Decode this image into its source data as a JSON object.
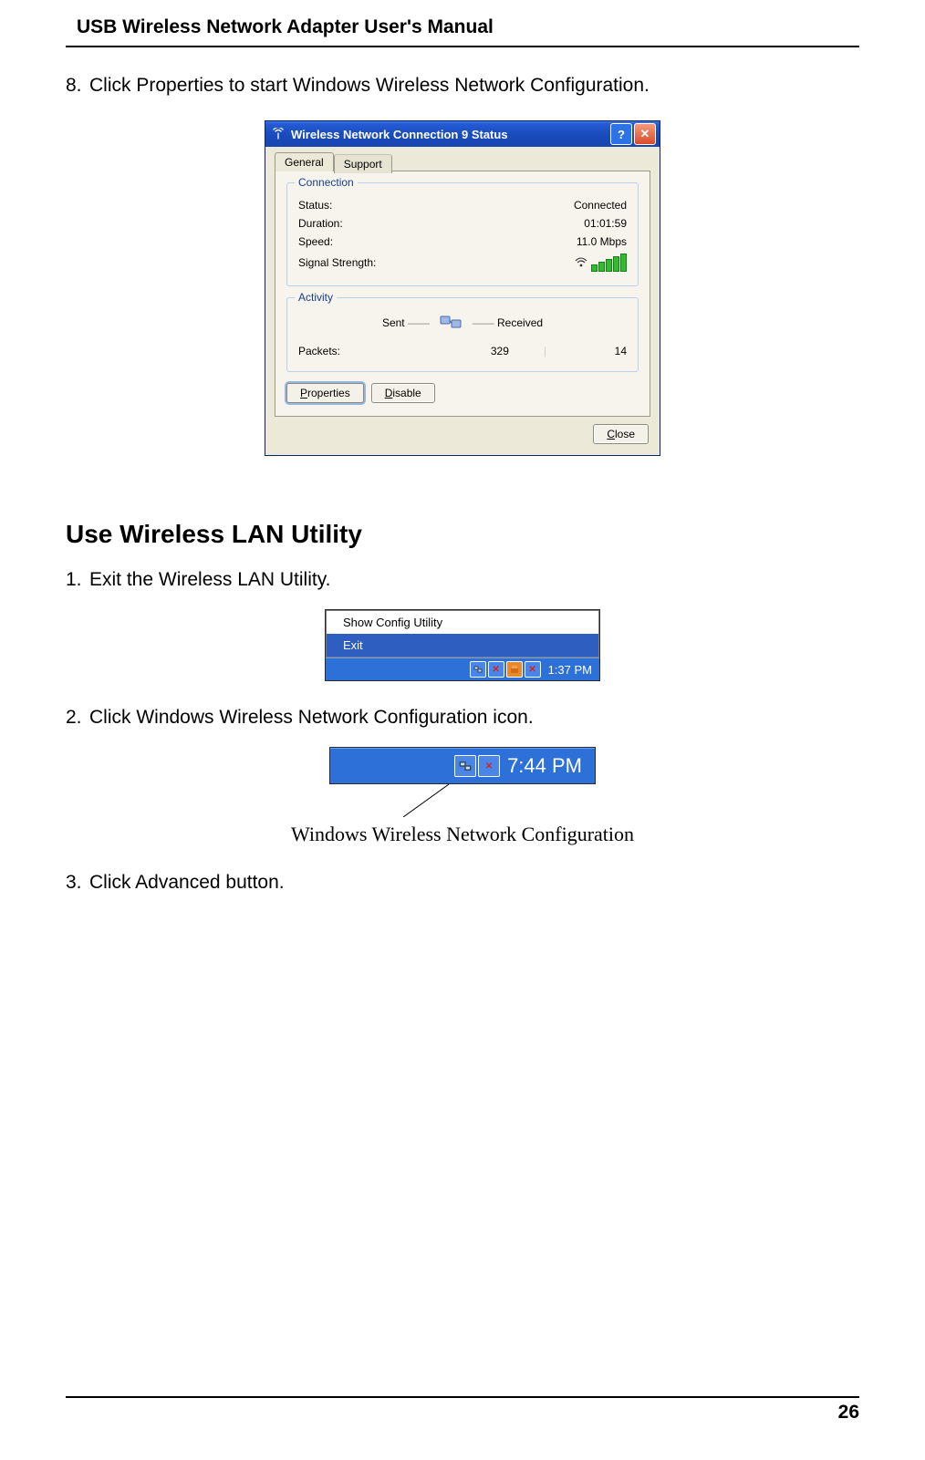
{
  "doc": {
    "header": "USB Wireless Network Adapter User's Manual",
    "page_number": "26"
  },
  "step8": {
    "num": "8.",
    "text": "Click Properties to start Windows Wireless Network Configuration."
  },
  "xp_dialog": {
    "title": "Wireless Network Connection 9 Status",
    "tabs": {
      "general": "General",
      "support": "Support"
    },
    "connection_group": {
      "title": "Connection",
      "status_label": "Status:",
      "status_value": "Connected",
      "duration_label": "Duration:",
      "duration_value": "01:01:59",
      "speed_label": "Speed:",
      "speed_value": "11.0 Mbps",
      "signal_label": "Signal Strength:"
    },
    "activity_group": {
      "title": "Activity",
      "sent_label": "Sent",
      "received_label": "Received",
      "packets_label": "Packets:",
      "sent_value": "329",
      "received_value": "14"
    },
    "buttons": {
      "properties": "Properties",
      "disable": "Disable",
      "close": "Close"
    }
  },
  "section_title": "Use Wireless LAN Utility",
  "step1": {
    "num": "1.",
    "text": "Exit the Wireless LAN Utility."
  },
  "context_menu": {
    "item_show": "Show Config Utility",
    "item_exit": "Exit",
    "clock": "1:37 PM"
  },
  "step2": {
    "num": "2.",
    "text": "Click Windows Wireless Network Configuration icon."
  },
  "tray2": {
    "clock": "7:44 PM"
  },
  "callout": "Windows Wireless Network Configuration",
  "step3": {
    "num": "3.",
    "text": "Click Advanced button."
  }
}
